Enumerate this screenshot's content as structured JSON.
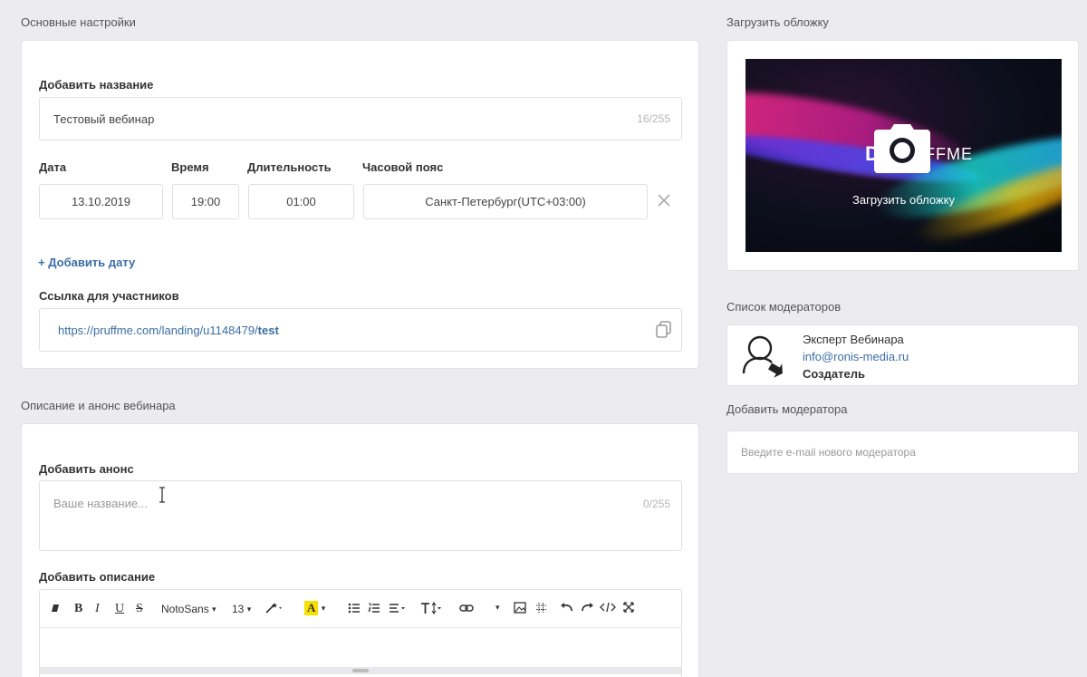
{
  "basic": {
    "section_title": "Основные настройки",
    "name_label": "Добавить название",
    "name_value": "Тестовый вебинар",
    "name_counter": "16/255",
    "date_label": "Дата",
    "time_label": "Время",
    "duration_label": "Длительность",
    "timezone_label": "Часовой пояс",
    "date_value": "13.10.2019",
    "time_value": "19:00",
    "duration_value": "01:00",
    "timezone_value": "Санкт-Петербург(UTC+03:00)",
    "add_date": "+  Добавить дату",
    "link_label": "Ссылка для участников",
    "link_base": "https://pruffme.com/landing/u1148479/",
    "link_slug": "test"
  },
  "description": {
    "section_title": "Описание и анонс вебинара",
    "announce_label": "Добавить анонс",
    "announce_placeholder": "Ваше название...",
    "announce_counter": "0/255",
    "desc_label": "Добавить описание",
    "toolbar": {
      "font": "NotoSans",
      "size": "13",
      "caret": "▾"
    }
  },
  "cover": {
    "section_title": "Загрузить обложку",
    "upload_label": "Загрузить обложку",
    "brand_left": "D",
    "brand_right": "FFME"
  },
  "moderators": {
    "section_title": "Список модераторов",
    "name": "Эксперт Вебинара",
    "email": "info@ronis-media.ru",
    "role": "Создатель",
    "add_title": "Добавить модератора",
    "add_placeholder": "Введите e-mail нового модератора"
  }
}
